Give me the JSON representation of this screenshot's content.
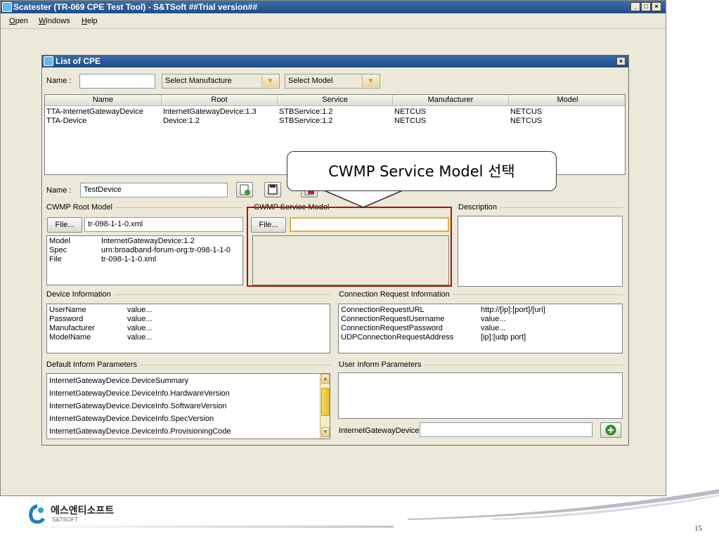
{
  "app": {
    "title": "Scatester (TR-069 CPE Test Tool) - S&TSoft ##Trial version##",
    "menu": [
      "Open",
      "Windows",
      "Help"
    ],
    "window_buttons": [
      "_",
      "□",
      "×"
    ]
  },
  "dialog": {
    "title": "List of CPE",
    "close": "×",
    "filter": {
      "name_label": "Name :",
      "name_value": "",
      "manufacturer_select": "Select Manufacture",
      "model_select": "Select Model"
    },
    "table": {
      "headers": [
        "Name",
        "Root",
        "Service",
        "Manufacturer",
        "Model"
      ],
      "rows": [
        [
          "TTA-InternetGatewayDevice",
          "InternetGatewayDevice:1.3",
          "STBService:1.2",
          "NETCUS",
          "NETCUS"
        ],
        [
          "TTA-Device",
          "Device:1.2",
          "STBService:1.2",
          "NETCUS",
          "NETCUS"
        ]
      ]
    },
    "device_name": {
      "label": "Name :",
      "value": "TestDevice"
    },
    "root_model": {
      "title": "CWMP Root Model",
      "file_button": "File...",
      "file_value": "tr-098-1-1-0.xml",
      "info": [
        {
          "key": "Model",
          "value": "InternetGatewayDevice:1.2"
        },
        {
          "key": "Spec",
          "value": "urn:broadband-forum-org:tr-098-1-1-0"
        },
        {
          "key": "File",
          "value": "tr-098-1-1-0.xml"
        }
      ]
    },
    "service_model": {
      "title": "CWMP Service Model",
      "file_button": "File...",
      "file_value": ""
    },
    "description": {
      "title": "Description",
      "value": ""
    },
    "device_info": {
      "title": "Device Information",
      "rows": [
        {
          "key": "UserName",
          "value": "value..."
        },
        {
          "key": "Password",
          "value": "value..."
        },
        {
          "key": "Manufacturer",
          "value": "value..."
        },
        {
          "key": "ModelName",
          "value": "value..."
        }
      ]
    },
    "connection_info": {
      "title": "Connection Request Information",
      "rows": [
        {
          "key": "ConnectionRequestURL",
          "value": "http://[ip]:[port]/[uri]"
        },
        {
          "key": "ConnectionRequestUsername",
          "value": "value..."
        },
        {
          "key": "ConnectionRequestPassword",
          "value": "value..."
        },
        {
          "key": "UDPConnectionRequestAddress",
          "value": "[ip]:[udp port]"
        }
      ]
    },
    "default_inform": {
      "title": "Default Inform Parameters",
      "items": [
        "InternetGatewayDevice.DeviceSummary",
        "InternetGatewayDevice.DeviceInfo.HardwareVersion",
        "InternetGatewayDevice.DeviceInfo.SoftwareVersion",
        "InternetGatewayDevice.DeviceInfo.SpecVersion",
        "InternetGatewayDevice.DeviceInfo.ProvisioningCode"
      ]
    },
    "user_inform": {
      "title": "User Inform Parameters",
      "prefix": "InternetGatewayDevice.",
      "input_value": ""
    }
  },
  "callout": {
    "text": "CWMP Service Model 선택"
  },
  "slide": {
    "logo_text": "에스엔티소프트",
    "logo_sub": "S&TSOFT",
    "page_number": "15"
  },
  "colors": {
    "titlebar": "#1f4f8a",
    "highlight": "#b01010",
    "window_bg": "#ece9d8"
  }
}
